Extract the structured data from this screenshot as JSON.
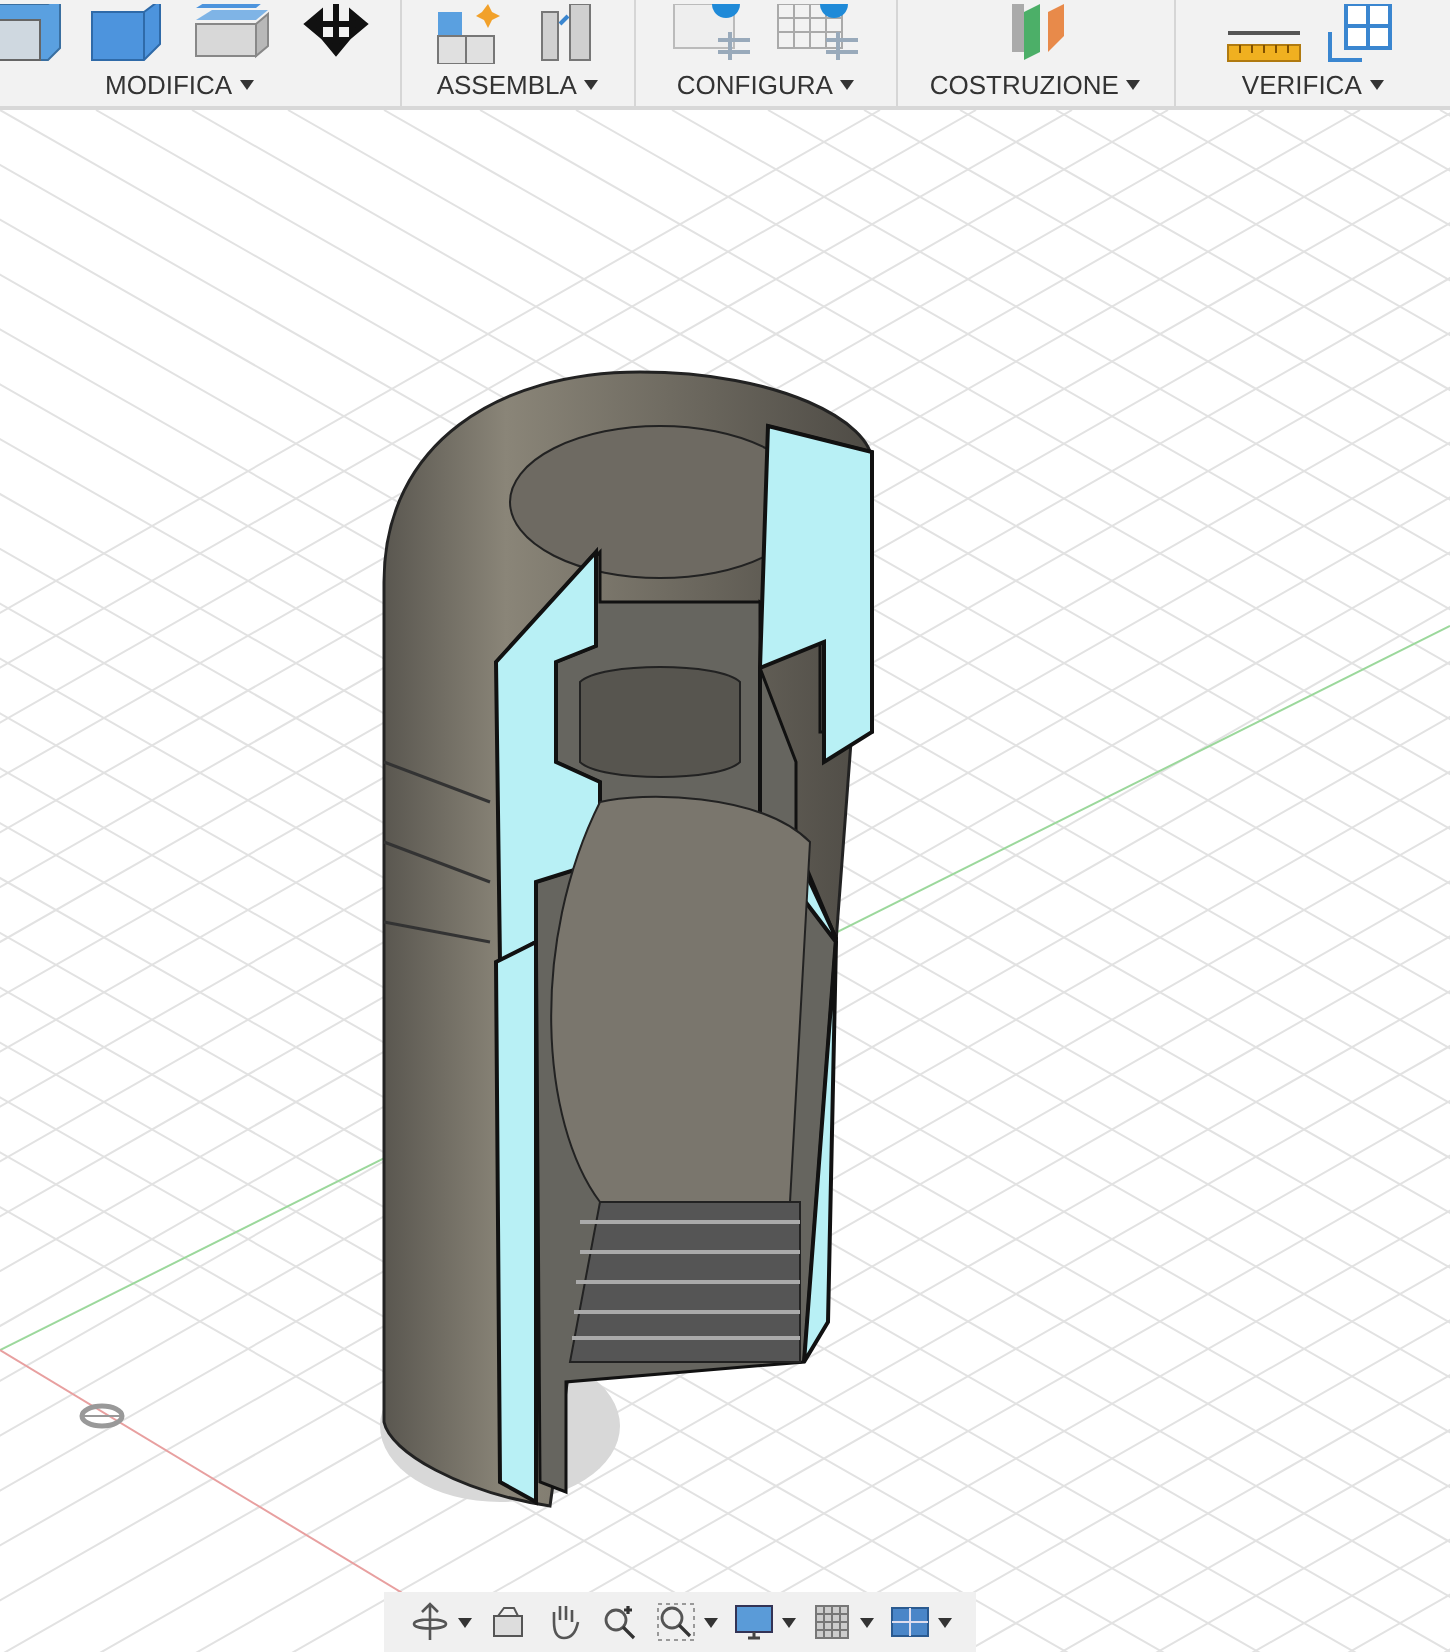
{
  "toolbar": {
    "groups": [
      {
        "label": "MODIFICA",
        "tools": [
          {
            "kind": "press"
          },
          {
            "kind": "fillet"
          },
          {
            "kind": "shell"
          },
          {
            "kind": "move"
          }
        ]
      },
      {
        "label": "ASSEMBLA",
        "tools": [
          {
            "kind": "component"
          },
          {
            "kind": "joint"
          }
        ]
      },
      {
        "label": "CONFIGURA",
        "tools": [
          {
            "kind": "table"
          },
          {
            "kind": "grid"
          }
        ]
      },
      {
        "label": "COSTRUZIONE",
        "tools": [
          {
            "kind": "plane"
          }
        ]
      },
      {
        "label": "VERIFICA",
        "tools": [
          {
            "kind": "measure"
          },
          {
            "kind": "section"
          }
        ]
      }
    ]
  },
  "navigation_bar": {
    "tools": [
      {
        "kind": "orbit",
        "dropdown": true
      },
      {
        "kind": "look",
        "dropdown": false
      },
      {
        "kind": "pan",
        "dropdown": false
      },
      {
        "kind": "zoom",
        "dropdown": false
      },
      {
        "kind": "fit",
        "dropdown": true
      },
      {
        "kind": "display",
        "dropdown": true
      },
      {
        "kind": "grid",
        "dropdown": true
      },
      {
        "kind": "viewports",
        "dropdown": true
      }
    ]
  }
}
